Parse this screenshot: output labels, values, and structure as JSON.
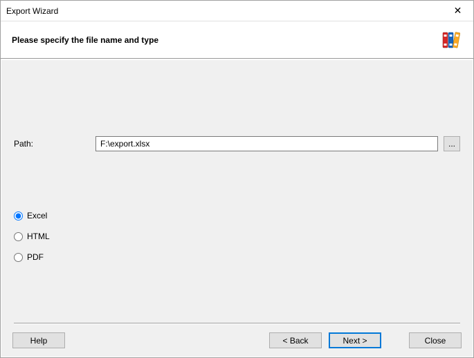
{
  "window": {
    "title": "Export Wizard",
    "close_glyph": "✕"
  },
  "header": {
    "title": "Please specify the file name and type"
  },
  "path": {
    "label": "Path:",
    "value": "F:\\export.xlsx",
    "browse_label": "..."
  },
  "formats": {
    "selected": "excel",
    "options": {
      "excel": "Excel",
      "html": "HTML",
      "pdf": "PDF"
    }
  },
  "buttons": {
    "help": "Help",
    "back": "< Back",
    "next": "Next >",
    "close": "Close"
  }
}
